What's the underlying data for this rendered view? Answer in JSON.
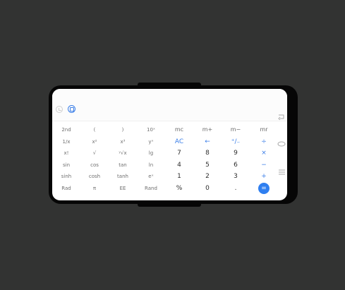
{
  "display": {
    "history_icon": "history-icon",
    "converter_icon": "unit-converter-icon"
  },
  "keypad": {
    "rows": [
      [
        "2nd",
        "(",
        ")",
        "10ˣ",
        "mc",
        "m+",
        "m−",
        "mr"
      ],
      [
        "1/x",
        "x²",
        "x³",
        "yˣ",
        "AC",
        "←",
        "⁺∕₋",
        "÷"
      ],
      [
        "x!",
        "√",
        "ʸ√x",
        "lg",
        "7",
        "8",
        "9",
        "×"
      ],
      [
        "sin",
        "cos",
        "tan",
        "ln",
        "4",
        "5",
        "6",
        "−"
      ],
      [
        "sinh",
        "cosh",
        "tanh",
        "eˣ",
        "1",
        "2",
        "3",
        "+"
      ],
      [
        "Rad",
        "π",
        "EE",
        "Rand",
        "%",
        "0",
        ".",
        "="
      ]
    ]
  },
  "nav": {
    "back_icon": "back-icon",
    "home_icon": "home-icon",
    "recents_icon": "recents-icon"
  },
  "colors": {
    "accent": "#2f7ff0",
    "background": "#323332",
    "screen": "#ffffff"
  }
}
